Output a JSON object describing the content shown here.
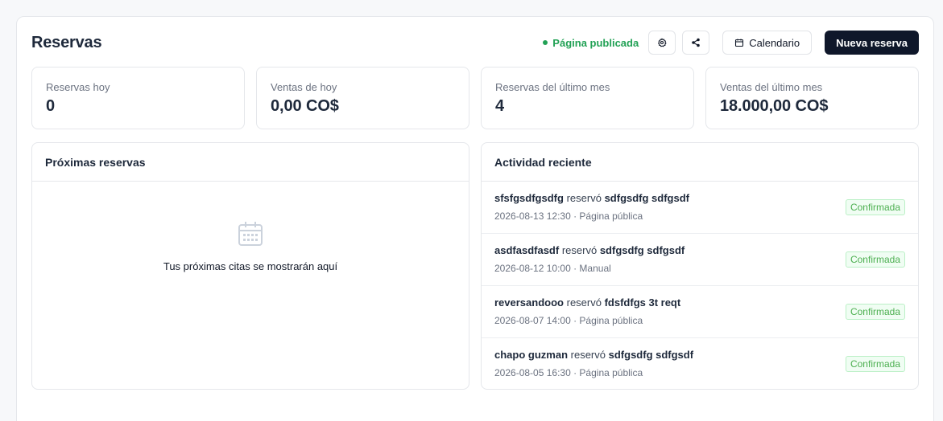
{
  "header": {
    "title": "Reservas",
    "status_text": "Página publicada",
    "calendar_label": "Calendario",
    "new_booking_label": "Nueva reserva"
  },
  "stats": [
    {
      "label": "Reservas hoy",
      "value": "0"
    },
    {
      "label": "Ventas de hoy",
      "value": "0,00 CO$"
    },
    {
      "label": "Reservas del último mes",
      "value": "4"
    },
    {
      "label": "Ventas del último mes",
      "value": "18.000,00 CO$"
    }
  ],
  "upcoming": {
    "title": "Próximas reservas",
    "empty_text": "Tus próximas citas se mostrarán aquí"
  },
  "activity": {
    "title": "Actividad reciente",
    "verb": "reservó",
    "items": [
      {
        "client": "sfsfgsdfgsdfg",
        "service": "sdfgsdfg sdfgsdf",
        "datetime": "2026-08-13 12:30",
        "source": "Página pública",
        "status": "Confirmada"
      },
      {
        "client": "asdfasdfasdf",
        "service": "sdfgsdfg sdfgsdf",
        "datetime": "2026-08-12 10:00",
        "source": "Manual",
        "status": "Confirmada"
      },
      {
        "client": "reversandooo",
        "service": "fdsfdfgs 3t reqt",
        "datetime": "2026-08-07 14:00",
        "source": "Página pública",
        "status": "Confirmada"
      },
      {
        "client": "chapo guzman",
        "service": "sdfgsdfg sdfgsdf",
        "datetime": "2026-08-05 16:30",
        "source": "Página pública",
        "status": "Confirmada"
      }
    ]
  },
  "colors": {
    "published": "#22a155",
    "primary_button": "#0f172a",
    "badge_text": "#4caf50",
    "badge_bg": "#f0fdf3"
  },
  "icons": {
    "settings": "gear-icon",
    "share": "share-icon",
    "calendar": "calendar-icon",
    "empty_state": "calendar-icon"
  }
}
